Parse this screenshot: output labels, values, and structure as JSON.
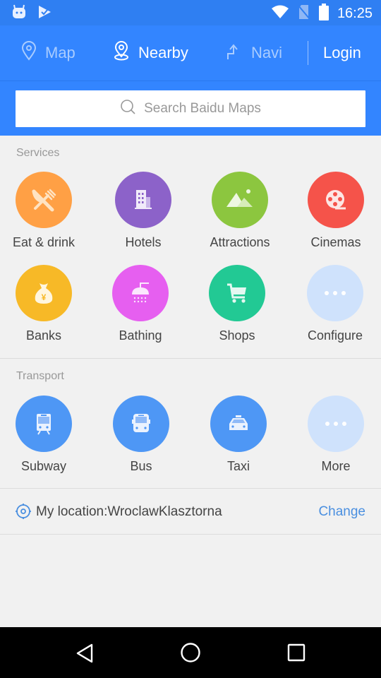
{
  "status_bar": {
    "time": "16:25",
    "left_icons": [
      "android-bot-icon",
      "play-store-check-icon"
    ],
    "right_icons": [
      "wifi-icon",
      "no-sim-icon",
      "battery-icon"
    ]
  },
  "top_nav": {
    "tabs": [
      {
        "label": "Map",
        "icon": "map-pin-icon",
        "active": false
      },
      {
        "label": "Nearby",
        "icon": "nearby-pin-icon",
        "active": true
      },
      {
        "label": "Navi",
        "icon": "navi-turn-icon",
        "active": false
      }
    ],
    "login_label": "Login"
  },
  "search": {
    "placeholder": "Search Baidu Maps"
  },
  "services": {
    "title": "Services",
    "items": [
      {
        "label": "Eat & drink",
        "icon": "fork-knife-icon",
        "color": "#ffa045"
      },
      {
        "label": "Hotels",
        "icon": "hotel-building-icon",
        "color": "#8c62c9"
      },
      {
        "label": "Attractions",
        "icon": "mountain-icon",
        "color": "#8cc63f"
      },
      {
        "label": "Cinemas",
        "icon": "film-reel-icon",
        "color": "#f5534a"
      },
      {
        "label": "Banks",
        "icon": "money-bag-icon",
        "color": "#f7b927"
      },
      {
        "label": "Bathing",
        "icon": "shower-icon",
        "color": "#e65ff0"
      },
      {
        "label": "Shops",
        "icon": "shopping-cart-icon",
        "color": "#22c994"
      },
      {
        "label": "Configure",
        "icon": "more-dots-icon",
        "color": "#cfe2fc"
      }
    ]
  },
  "transport": {
    "title": "Transport",
    "items": [
      {
        "label": "Subway",
        "icon": "subway-train-icon",
        "color": "#4e97f5"
      },
      {
        "label": "Bus",
        "icon": "bus-icon",
        "color": "#4e97f5"
      },
      {
        "label": "Taxi",
        "icon": "taxi-icon",
        "color": "#4e97f5"
      },
      {
        "label": "More",
        "icon": "more-dots-icon",
        "color": "#cfe2fc"
      }
    ]
  },
  "location": {
    "text": "My location:WroclawKlasztorna",
    "change_label": "Change"
  },
  "android_nav": {
    "buttons": [
      "back",
      "home",
      "recents"
    ]
  }
}
